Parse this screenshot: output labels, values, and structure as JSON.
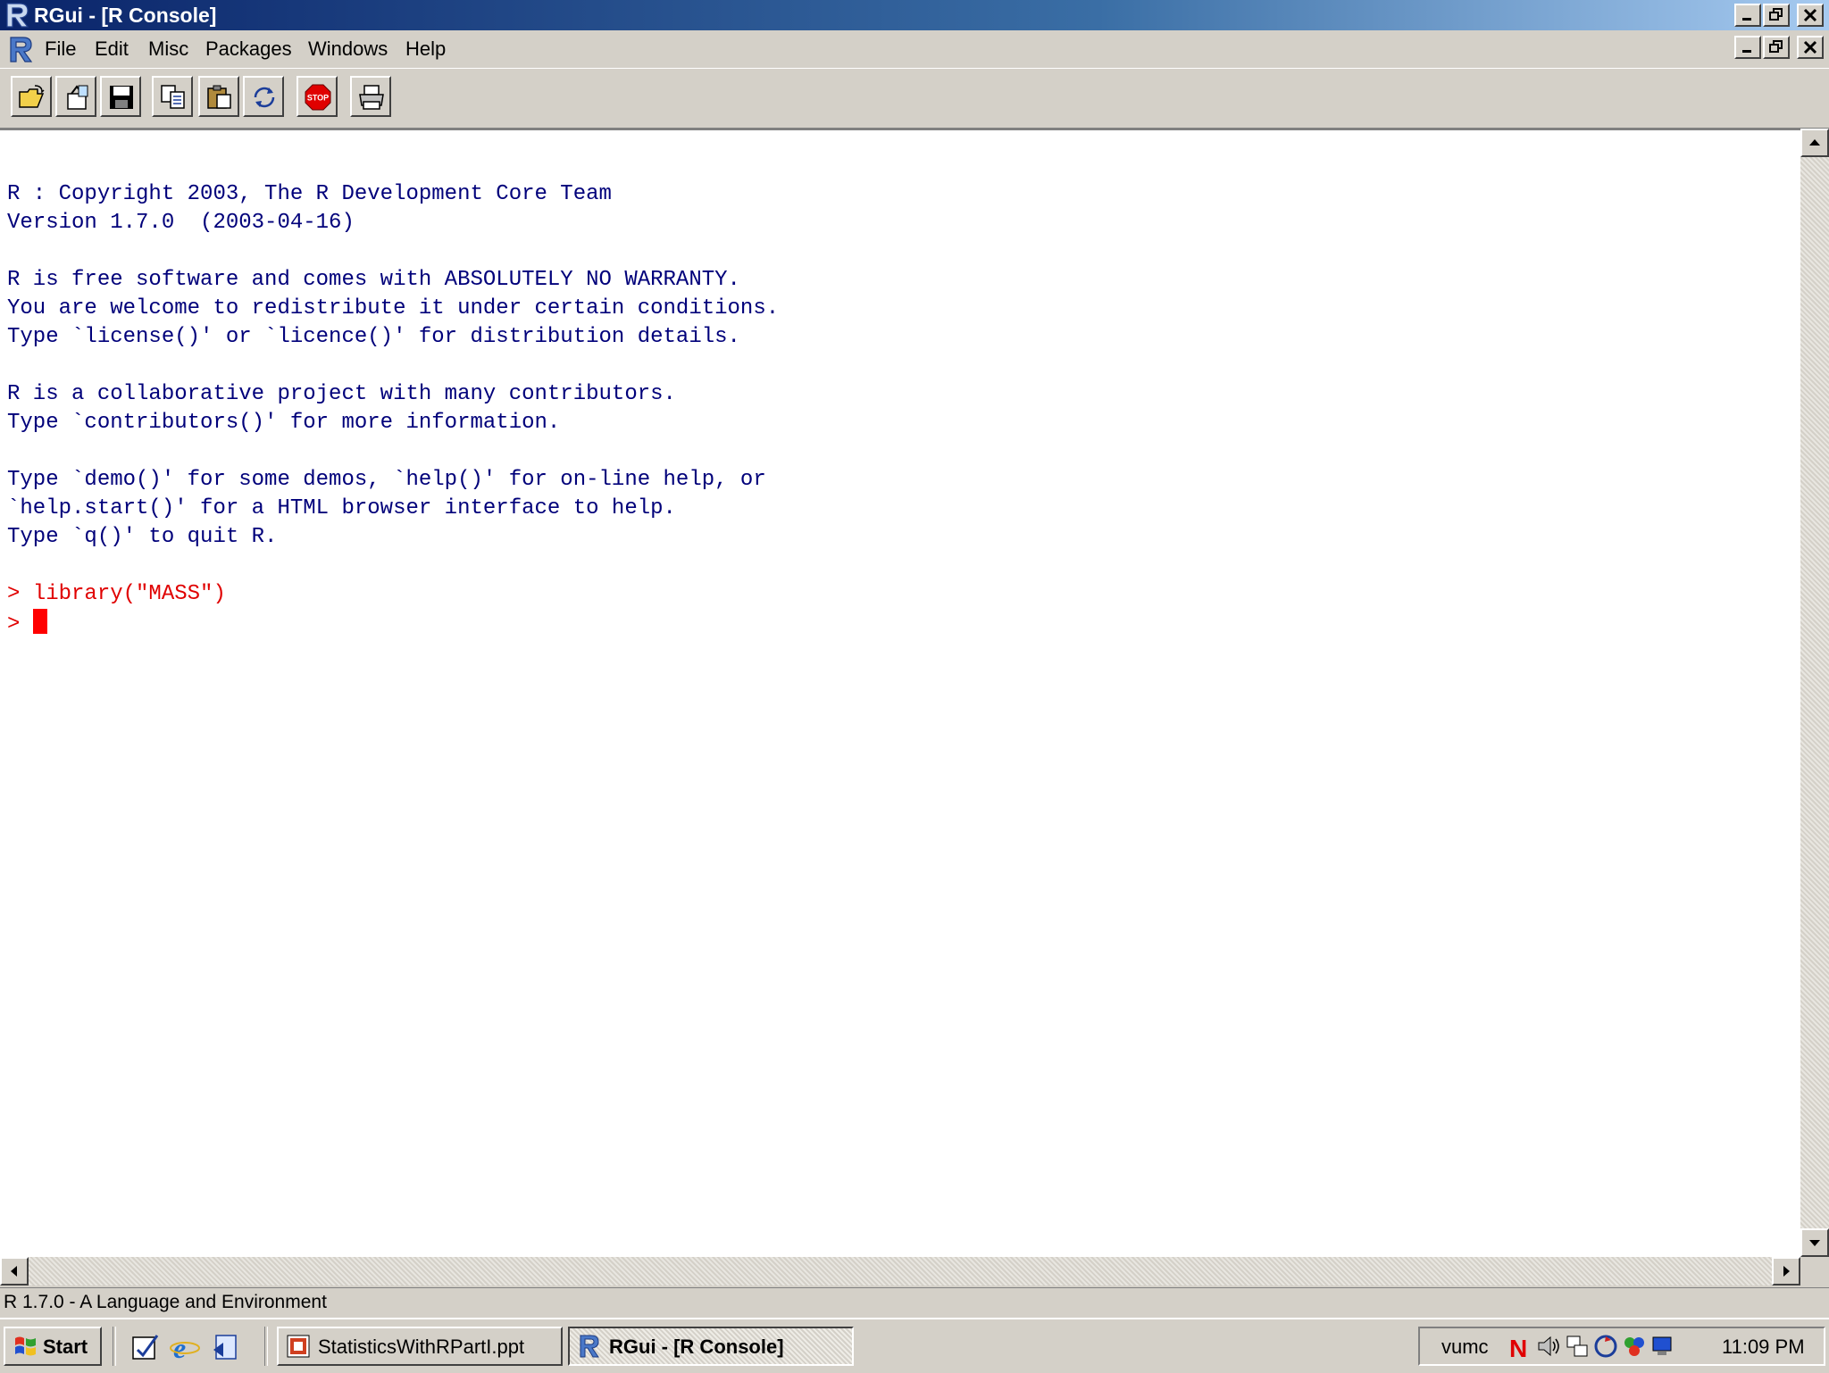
{
  "window": {
    "title": "RGui - [R Console]"
  },
  "menu": [
    "File",
    "Edit",
    "Misc",
    "Packages",
    "Windows",
    "Help"
  ],
  "toolbar": {
    "buttons": [
      "open-script-icon",
      "load-workspace-icon",
      "save-icon",
      "copy-icon",
      "paste-icon",
      "refresh-icon",
      "stop-icon",
      "print-icon"
    ],
    "stop_label": "STOP"
  },
  "console": {
    "lines": [
      "R : Copyright 2003, The R Development Core Team",
      "Version 1.7.0  (2003-04-16)",
      "",
      "R is free software and comes with ABSOLUTELY NO WARRANTY.",
      "You are welcome to redistribute it under certain conditions.",
      "Type `license()' or `licence()' for distribution details.",
      "",
      "R is a collaborative project with many contributors.",
      "Type `contributors()' for more information.",
      "",
      "Type `demo()' for some demos, `help()' for on-line help, or",
      "`help.start()' for a HTML browser interface to help.",
      "Type `q()' to quit R."
    ],
    "prompt": ">",
    "command": "library(\"MASS\")"
  },
  "statusbar": {
    "text": "R 1.7.0 - A Language and Environment"
  },
  "taskbar": {
    "start_label": "Start",
    "tasks": [
      {
        "label": "StatisticsWithRPartI.ppt",
        "active": false
      },
      {
        "label": "RGui - [R Console]",
        "active": true
      }
    ],
    "tray_user": "vumc",
    "tray_n": "N",
    "clock": "11:09 PM"
  },
  "colors": {
    "output_text": "#00007a",
    "command_text": "#e00000",
    "cursor": "#ff0000",
    "titlebar_start": "#0a246a",
    "titlebar_end": "#a6caf0"
  }
}
